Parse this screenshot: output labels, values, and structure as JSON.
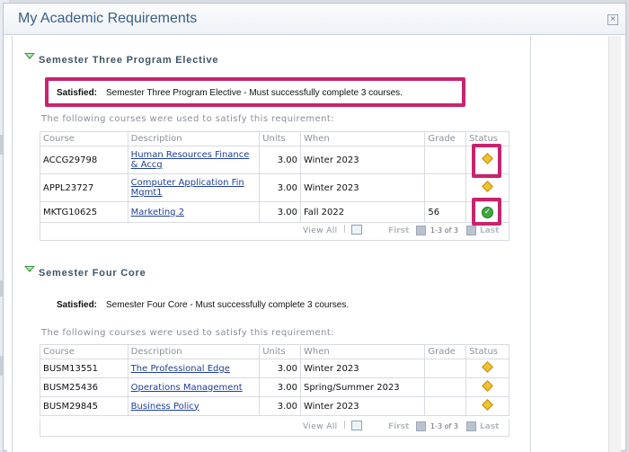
{
  "dialog": {
    "title": "My Academic Requirements",
    "close_label": "×"
  },
  "groups": [
    {
      "title": "Semester Three Program Elective",
      "satisfied_label": "Satisfied:",
      "satisfied_text": "Semester Three Program Elective - Must successfully complete 3 courses.",
      "used_note": "The following courses were used to satisfy this requirement:",
      "headers": [
        "Course",
        "Description",
        "Units",
        "When",
        "Grade",
        "Status"
      ],
      "rows": [
        {
          "course": "ACCG29798",
          "description": "Human Resources Finance & Accg",
          "units": "3.00",
          "when": "Winter 2023",
          "grade": "",
          "status": "in-progress-icon"
        },
        {
          "course": "APPL23727",
          "description": "Computer Application Fin Mgmt1",
          "units": "3.00",
          "when": "Winter 2023",
          "grade": "",
          "status": "in-progress-icon"
        },
        {
          "course": "MKTG10625",
          "description": "Marketing 2",
          "units": "3.00",
          "when": "Fall 2022",
          "grade": "56",
          "status": "taken-icon"
        }
      ],
      "footer": {
        "view_all": "View All",
        "separator": "|",
        "first": "First",
        "count": "1-3 of 3",
        "last": "Last"
      }
    },
    {
      "title": "Semester Four Core",
      "satisfied_label": "Satisfied:",
      "satisfied_text": "Semester Four Core - Must successfully complete 3 courses.",
      "used_note": "The following courses were used to satisfy this requirement:",
      "headers": [
        "Course",
        "Description",
        "Units",
        "When",
        "Grade",
        "Status"
      ],
      "rows": [
        {
          "course": "BUSM13551",
          "description": "The Professional Edge",
          "units": "3.00",
          "when": "Winter 2023",
          "grade": "",
          "status": "in-progress-icon"
        },
        {
          "course": "BUSM25436",
          "description": "Operations Management",
          "units": "3.00",
          "when": "Spring/Summer 2023",
          "grade": "",
          "status": "in-progress-icon"
        },
        {
          "course": "BUSM29845",
          "description": "Business Policy",
          "units": "3.00",
          "when": "Winter 2023",
          "grade": "",
          "status": "in-progress-icon"
        }
      ],
      "footer": {
        "view_all": "View All",
        "separator": "|",
        "first": "First",
        "count": "1-3 of 3",
        "last": "Last"
      }
    }
  ],
  "colors": {
    "highlight": "#c8246e",
    "in_progress": "#f2c12e",
    "taken": "#3ea63e",
    "link": "#1f3f9a"
  }
}
